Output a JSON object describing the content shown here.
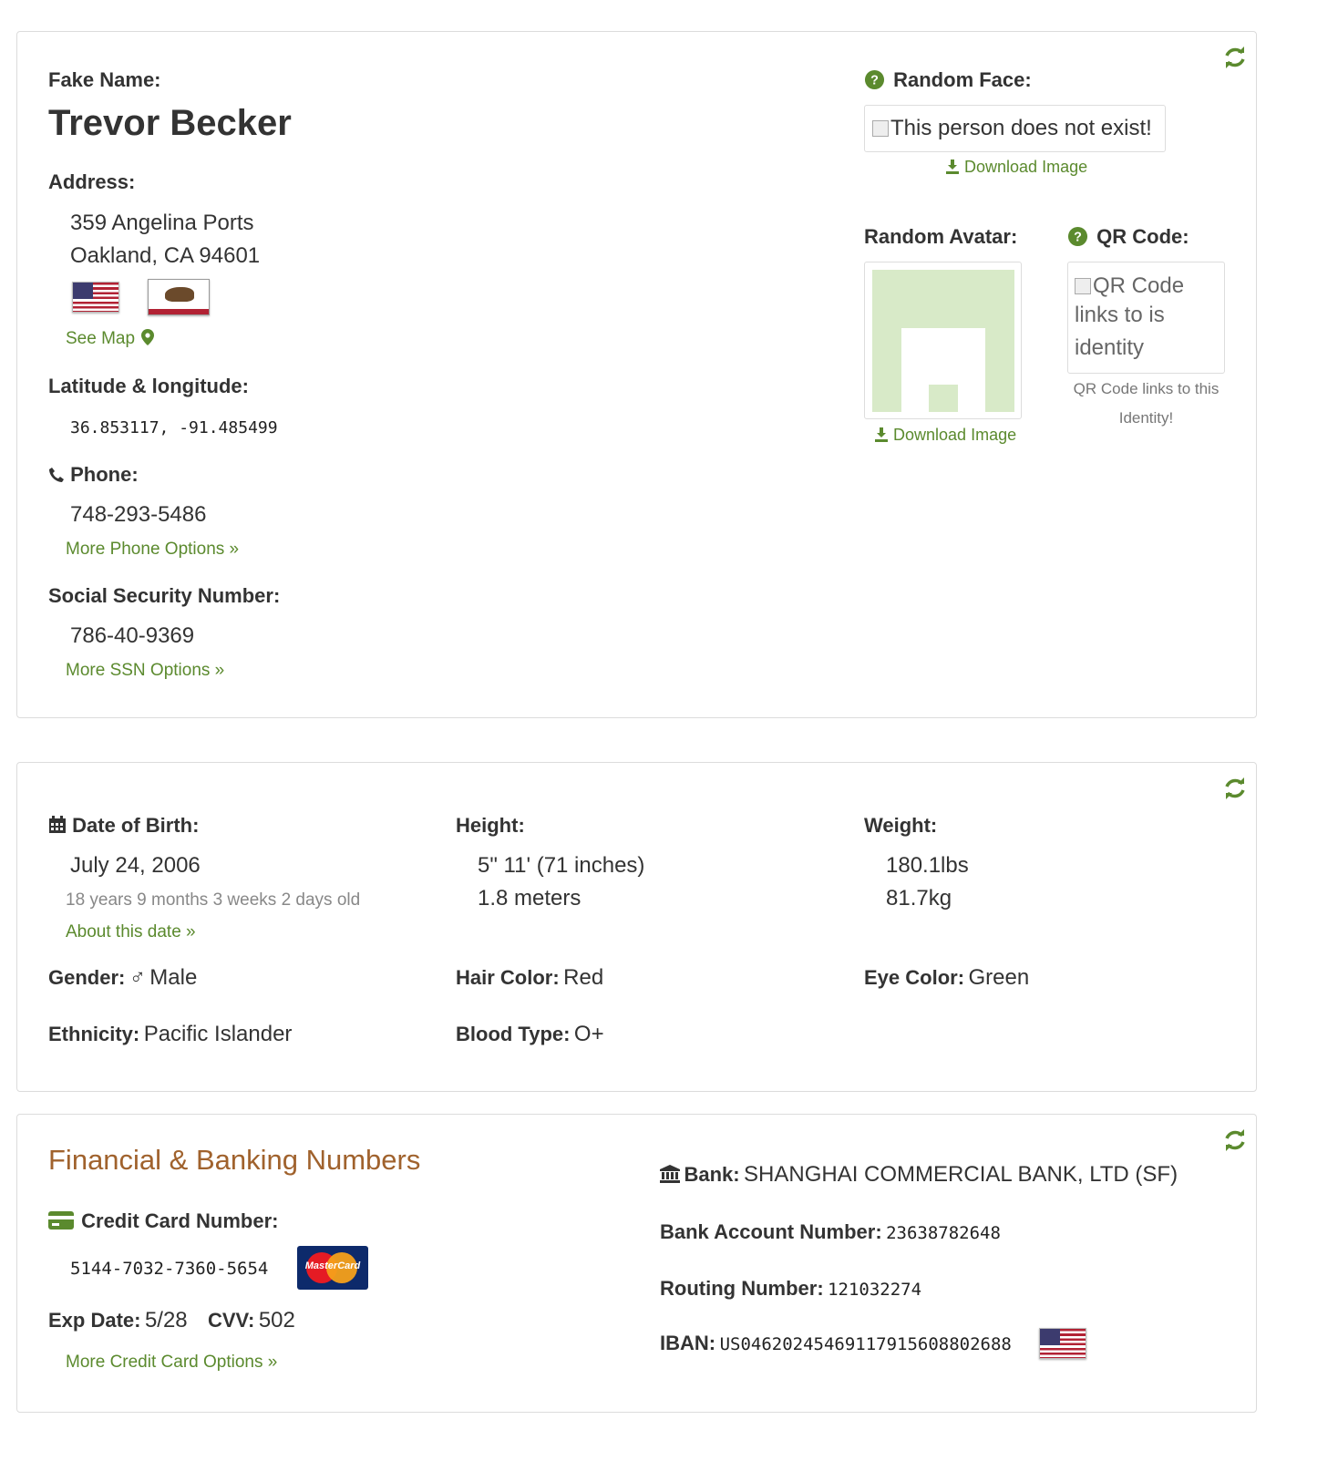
{
  "identity": {
    "fake_name_label": "Fake Name:",
    "name": "Trevor Becker",
    "address_label": "Address:",
    "address_line1": "359 Angelina Ports",
    "address_line2": "Oakland, CA 94601",
    "see_map": "See Map",
    "latlong_label": "Latitude & longitude:",
    "latlong": "36.853117, -91.485499",
    "phone_label": "Phone:",
    "phone": "748-293-5486",
    "more_phone": "More Phone Options »",
    "ssn_label": "Social Security Number:",
    "ssn": "786-40-9369",
    "more_ssn": "More SSN Options »"
  },
  "media": {
    "random_face_label": "Random Face:",
    "face_alt": "This person does not exist!",
    "download_image": "Download Image",
    "random_avatar_label": "Random Avatar:",
    "qr_label": "QR Code:",
    "qr_alt_1": "QR Code",
    "qr_alt_2": "links to is",
    "qr_alt_3": "identity",
    "qr_caption_1": "QR Code links to this",
    "qr_caption_2": "Identity!"
  },
  "physical": {
    "dob_label": "Date of Birth:",
    "dob": "July 24, 2006",
    "age": "18 years 9 months 3 weeks 2 days old",
    "about_date": "About this date »",
    "height_label": "Height:",
    "height_imperial": "5\" 11' (71 inches)",
    "height_metric": "1.8 meters",
    "weight_label": "Weight:",
    "weight_lbs": "180.1lbs",
    "weight_kg": "81.7kg",
    "gender_label": "Gender:",
    "gender": "Male",
    "hair_label": "Hair Color:",
    "hair": "Red",
    "eye_label": "Eye Color:",
    "eye": "Green",
    "ethnicity_label": "Ethnicity:",
    "ethnicity": "Pacific Islander",
    "blood_label": "Blood Type:",
    "blood": "O+"
  },
  "financial": {
    "heading": "Financial & Banking Numbers",
    "cc_label": "Credit Card Number:",
    "cc_number": "5144-7032-7360-5654",
    "cc_brand": "MasterCard",
    "exp_label": "Exp Date:",
    "exp": "5/28",
    "cvv_label": "CVV:",
    "cvv": "502",
    "more_cc": "More Credit Card Options »",
    "bank_label": "Bank:",
    "bank": "SHANGHAI COMMERCIAL BANK, LTD (SF)",
    "account_label": "Bank Account Number:",
    "account": "23638782648",
    "routing_label": "Routing Number:",
    "routing": "121032274",
    "iban_label": "IBAN:",
    "iban": "US04620245469117915608802688"
  },
  "colors": {
    "accent_green": "#5b8a2e",
    "heading_brown": "#a0622d",
    "avatar_green": "#d8eac8"
  }
}
